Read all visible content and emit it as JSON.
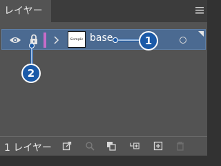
{
  "tab": {
    "label": "レイヤー"
  },
  "layer": {
    "name": "base",
    "thumbnail_text": "Sample",
    "color": "#c76cc8"
  },
  "callouts": [
    "1",
    "2"
  ],
  "footer": {
    "count_label": "1 レイヤー"
  },
  "icons": [
    "panel-menu-icon",
    "eye-icon",
    "lock-icon",
    "chevron-right-icon",
    "target-icon",
    "export-icon",
    "search-icon",
    "clipping-mask-icon",
    "new-sublayer-icon",
    "new-layer-icon",
    "trash-icon"
  ]
}
